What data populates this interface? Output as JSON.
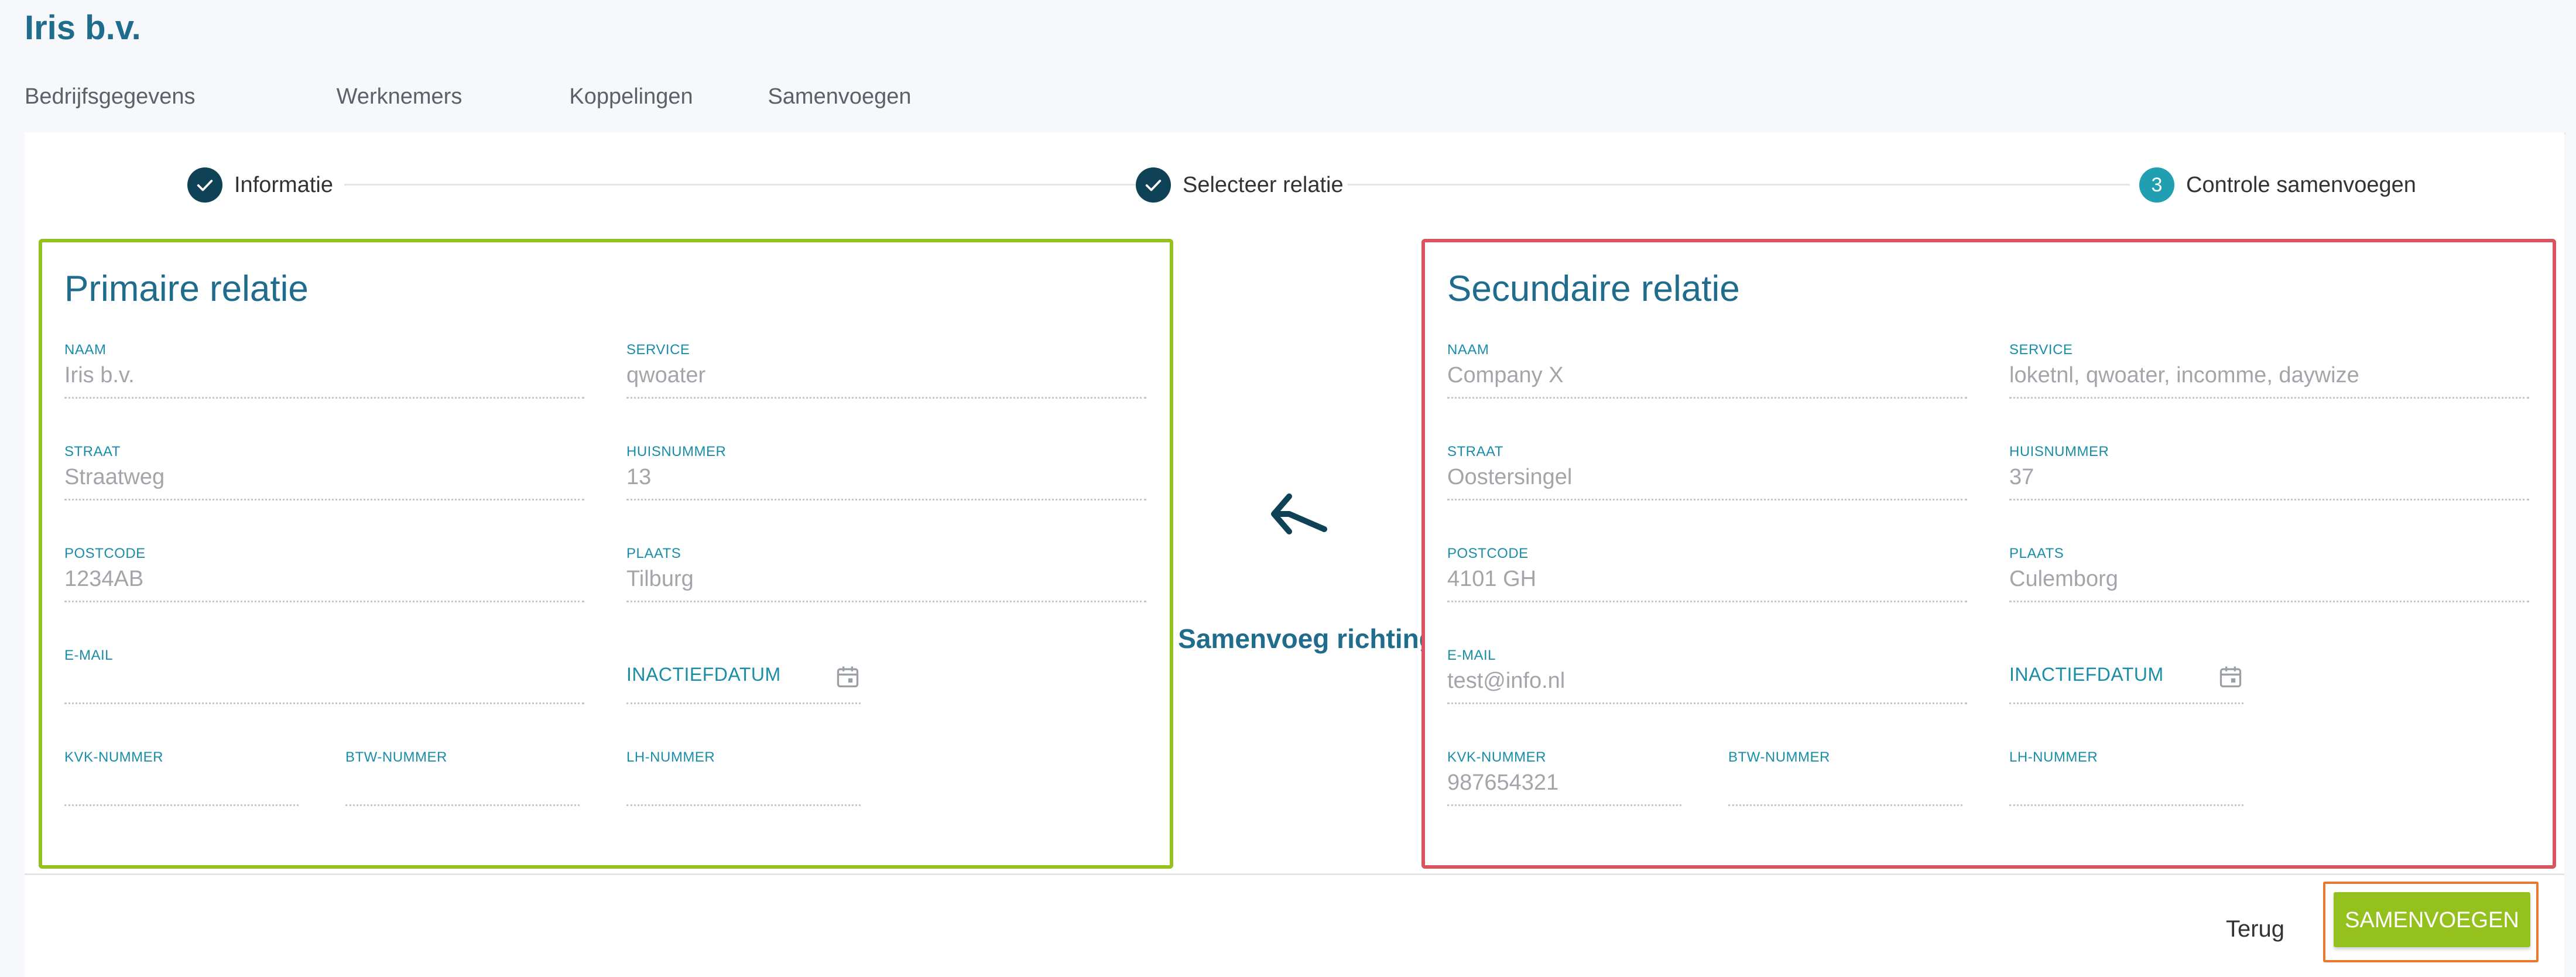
{
  "company_title": "Iris b.v.",
  "tabs": [
    {
      "label": "Bedrijfsgegevens",
      "active": false
    },
    {
      "label": "Werknemers",
      "active": false
    },
    {
      "label": "Koppelingen",
      "active": false
    },
    {
      "label": "Samenvoegen",
      "active": true
    }
  ],
  "stepper": {
    "steps": [
      {
        "label": "Informatie",
        "state": "done"
      },
      {
        "label": "Selecteer relatie",
        "state": "done"
      },
      {
        "number": "3",
        "label": "Controle samenvoegen",
        "state": "current"
      }
    ]
  },
  "primary": {
    "title": "Primaire relatie",
    "naam": {
      "label": "NAAM",
      "value": "Iris b.v."
    },
    "service": {
      "label": "SERVICE",
      "value": "qwoater"
    },
    "straat": {
      "label": "STRAAT",
      "value": "Straatweg"
    },
    "huisnummer": {
      "label": "HUISNUMMER",
      "value": "13"
    },
    "postcode": {
      "label": "POSTCODE",
      "value": "1234AB"
    },
    "plaats": {
      "label": "PLAATS",
      "value": "Tilburg"
    },
    "email": {
      "label": "E-MAIL",
      "value": ""
    },
    "inactiefdatum": {
      "label": "INACTIEFDATUM",
      "value": ""
    },
    "kvk": {
      "label": "KVK-NUMMER",
      "value": ""
    },
    "btw": {
      "label": "BTW-NUMMER",
      "value": ""
    },
    "lh": {
      "label": "LH-NUMMER",
      "value": ""
    }
  },
  "secondary": {
    "title": "Secundaire relatie",
    "naam": {
      "label": "NAAM",
      "value": "Company X"
    },
    "service": {
      "label": "SERVICE",
      "value": "loketnl, qwoater, incomme, daywize"
    },
    "straat": {
      "label": "STRAAT",
      "value": "Oostersingel"
    },
    "huisnummer": {
      "label": "HUISNUMMER",
      "value": "37"
    },
    "postcode": {
      "label": "POSTCODE",
      "value": "4101 GH"
    },
    "plaats": {
      "label": "PLAATS",
      "value": "Culemborg"
    },
    "email": {
      "label": "E-MAIL",
      "value": "test@info.nl"
    },
    "inactiefdatum": {
      "label": "INACTIEFDATUM",
      "value": ""
    },
    "kvk": {
      "label": "KVK-NUMMER",
      "value": "987654321"
    },
    "btw": {
      "label": "BTW-NUMMER",
      "value": ""
    },
    "lh": {
      "label": "LH-NUMMER",
      "value": ""
    }
  },
  "direction": {
    "label": "Samenvoeg richting",
    "icon": "merge-left-arrow-icon"
  },
  "footer": {
    "back_label": "Terug",
    "merge_label": "SAMENVOEGEN"
  },
  "colors": {
    "brand": "#1f6c8c",
    "accent": "#1a8da8",
    "primary_border": "#95c11f",
    "secondary_border": "#d9545e",
    "merge_button": "#95c11f",
    "focus_outline": "#e8792e",
    "step_done": "#0f4256",
    "step_current": "#1f9fb0"
  }
}
